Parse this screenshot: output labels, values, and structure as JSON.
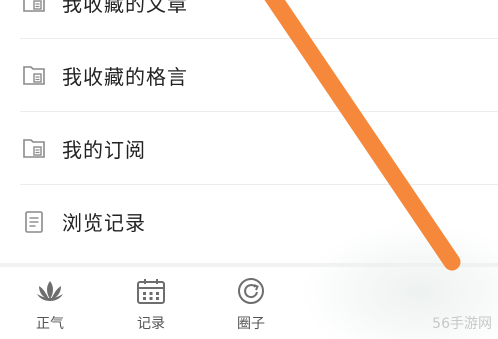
{
  "menu": {
    "items": [
      {
        "label": "我收藏的文章",
        "icon": "folder-doc-icon"
      },
      {
        "label": "我收藏的格言",
        "icon": "folder-doc-icon"
      },
      {
        "label": "我的订阅",
        "icon": "folder-doc-icon"
      },
      {
        "label": "浏览记录",
        "icon": "document-icon"
      }
    ]
  },
  "tabbar": {
    "tabs": [
      {
        "label": "正气",
        "icon": "lotus-icon"
      },
      {
        "label": "记录",
        "icon": "calendar-icon"
      },
      {
        "label": "圈子",
        "icon": "circle-refresh-icon"
      }
    ]
  },
  "overlay": {
    "stroke_color": "#f5883a"
  },
  "watermark": {
    "text": "56手游网"
  }
}
